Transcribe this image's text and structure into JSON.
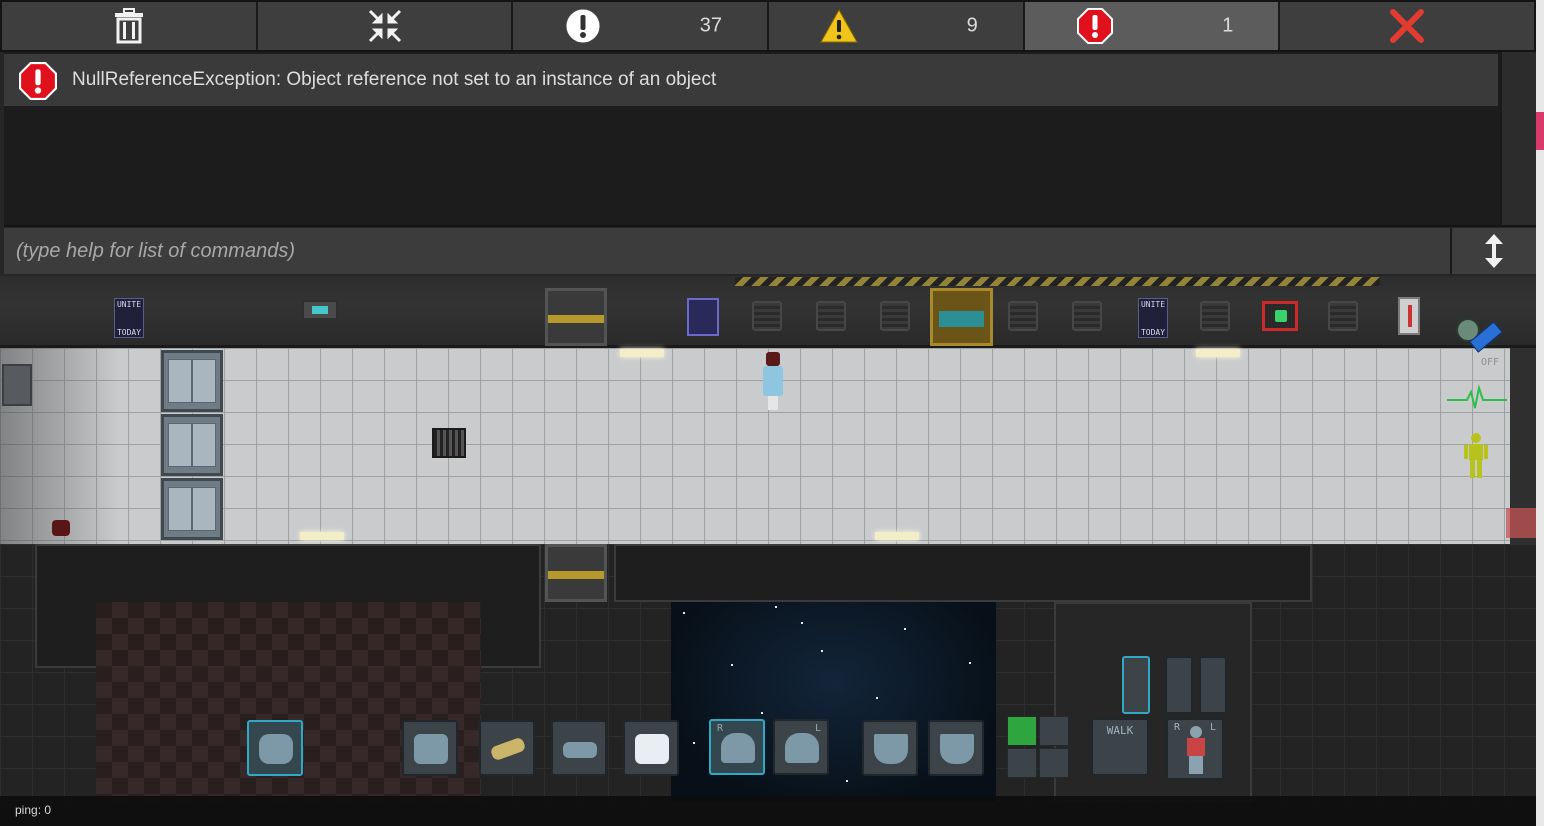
{
  "toolbar": {
    "clear_icon": "trash-icon",
    "collapse_icon": "collapse-arrows-icon",
    "log_count": "37",
    "warning_count": "9",
    "error_count": "1",
    "close_icon": "close-x-icon"
  },
  "console": {
    "entries": [
      {
        "type": "error",
        "message": "NullReferenceException: Object reference not set to an instance of an object"
      }
    ],
    "input_placeholder": "(type help for list of commands)",
    "resize_icon": "vertical-resize-icon"
  },
  "world": {
    "poster_left": {
      "line1": "UNITE",
      "line2": "TODAY"
    },
    "poster_right": {
      "line1": "UNITE",
      "line2": "TODAY"
    }
  },
  "hud": {
    "tank_status": "OFF",
    "walk_label": "WALK",
    "hand_right": "R",
    "hand_left": "L",
    "target_r": "R",
    "target_l": "L",
    "intent": "help"
  },
  "status": {
    "ping": "ping: 0"
  },
  "colors": {
    "error": "#e0101c",
    "warning": "#f0c419",
    "info": "#ffffff",
    "close": "#e23b2f",
    "help_intent": "#2ea53f"
  }
}
